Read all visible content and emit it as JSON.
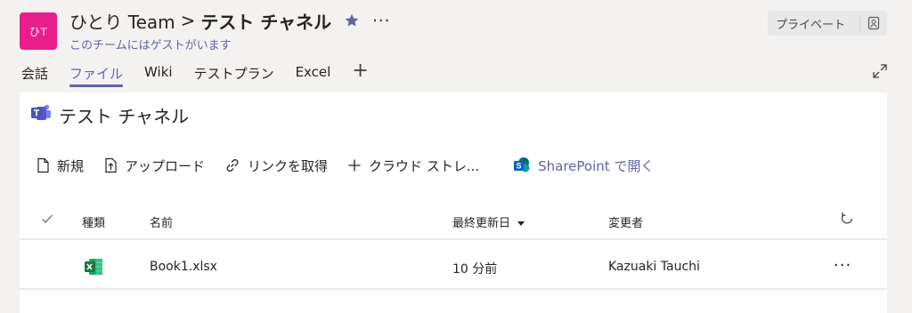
{
  "header": {
    "avatar_initials": "ひT",
    "team_name": "ひとり Team",
    "separator": ">",
    "channel_name": "テスト チャネル",
    "more_label": "···",
    "guest_note": "このチームにはゲストがいます",
    "privacy_label": "プライベート"
  },
  "tabs": [
    {
      "label": "会話",
      "active": false
    },
    {
      "label": "ファイル",
      "active": true
    },
    {
      "label": "Wiki",
      "active": false
    },
    {
      "label": "テストプラン",
      "active": false
    },
    {
      "label": "Excel",
      "active": false
    }
  ],
  "tab_add_label": "+",
  "files": {
    "title": "テスト チャネル",
    "commands": {
      "new": "新規",
      "upload": "アップロード",
      "get_link": "リンクを取得",
      "add_cloud": "クラウド ストレ...",
      "open_sharepoint": "SharePoint で開く"
    },
    "columns": {
      "type": "種類",
      "name": "名前",
      "modified": "最終更新日",
      "modified_by": "変更者"
    },
    "rows": [
      {
        "icon": "excel-icon",
        "name": "Book1.xlsx",
        "modified": "10 分前",
        "modified_by": "Kazuaki Tauchi",
        "more": "···"
      }
    ]
  },
  "colors": {
    "accent": "#6264a7",
    "avatar_bg": "#e91e8c",
    "excel_green": "#1d6f42",
    "sharepoint_blue": "#0364b8",
    "page_bg": "#f3f2f1"
  }
}
